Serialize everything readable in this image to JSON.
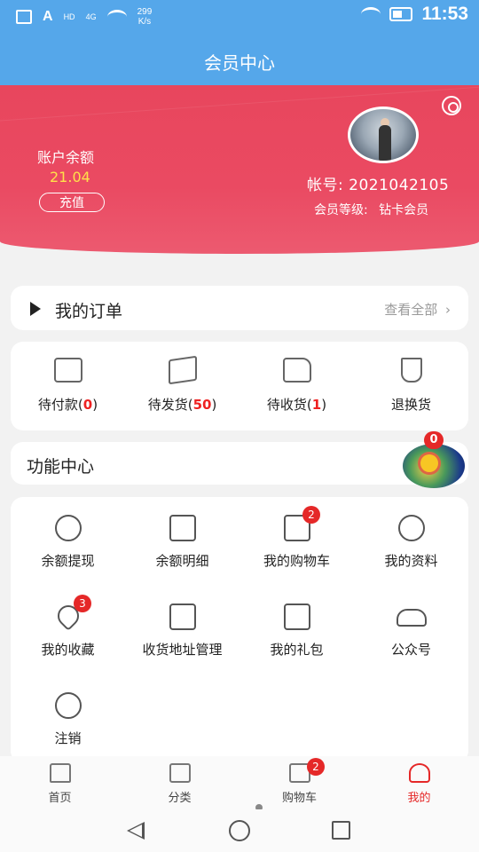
{
  "status_bar": {
    "time": "11:53",
    "net_speed": "299",
    "net_unit": "K/s",
    "net_type": "4G",
    "hd": "HD",
    "app_icon": "A"
  },
  "title": "会员中心",
  "profile": {
    "balance_label": "账户余额",
    "balance_value": "21.04",
    "recharge_label": "充值",
    "account_label": "帐号:",
    "account_value": "2021042105",
    "level_label": "会员等级:",
    "level_value": "钻卡会员",
    "settings_icon": "gear-icon",
    "avatar_icon": "avatar"
  },
  "orders": {
    "title": "我的订单",
    "view_all": "查看全部",
    "items": [
      {
        "label": "待付款",
        "count": "0",
        "icon": "id-card-icon"
      },
      {
        "label": "待发货",
        "count": "50",
        "icon": "box-icon"
      },
      {
        "label": "待收货",
        "count": "1",
        "icon": "truck-icon"
      },
      {
        "label": "退换货",
        "count": "",
        "icon": "plug-icon"
      }
    ]
  },
  "functions": {
    "title": "功能中心",
    "floating_badge": "0",
    "items": [
      {
        "label": "余额提现",
        "icon": "yuan-withdraw-icon",
        "badge": ""
      },
      {
        "label": "余额明细",
        "icon": "clipboard-yuan-icon",
        "badge": ""
      },
      {
        "label": "我的购物车",
        "icon": "cart-icon",
        "badge": "2"
      },
      {
        "label": "我的资料",
        "icon": "profile-icon",
        "badge": ""
      },
      {
        "label": "我的收藏",
        "icon": "heart-icon",
        "badge": "3"
      },
      {
        "label": "收货地址管理",
        "icon": "truck-icon",
        "badge": ""
      },
      {
        "label": "我的礼包",
        "icon": "qr-code-icon",
        "badge": ""
      },
      {
        "label": "公众号",
        "icon": "people-icon",
        "badge": ""
      },
      {
        "label": "注销",
        "icon": "logout-icon",
        "badge": ""
      }
    ]
  },
  "bottom_nav": {
    "items": [
      {
        "label": "首页",
        "icon": "home-icon",
        "badge": "",
        "active": false
      },
      {
        "label": "分类",
        "icon": "category-icon",
        "badge": "",
        "active": false
      },
      {
        "label": "购物车",
        "icon": "cart-icon",
        "badge": "2",
        "active": false
      },
      {
        "label": "我的",
        "icon": "user-icon",
        "badge": "",
        "active": true
      }
    ]
  },
  "colors": {
    "title_bar": "#55a7ea",
    "hero": "#e8465d",
    "accent": "#e52828",
    "balance": "#ffe14a"
  }
}
